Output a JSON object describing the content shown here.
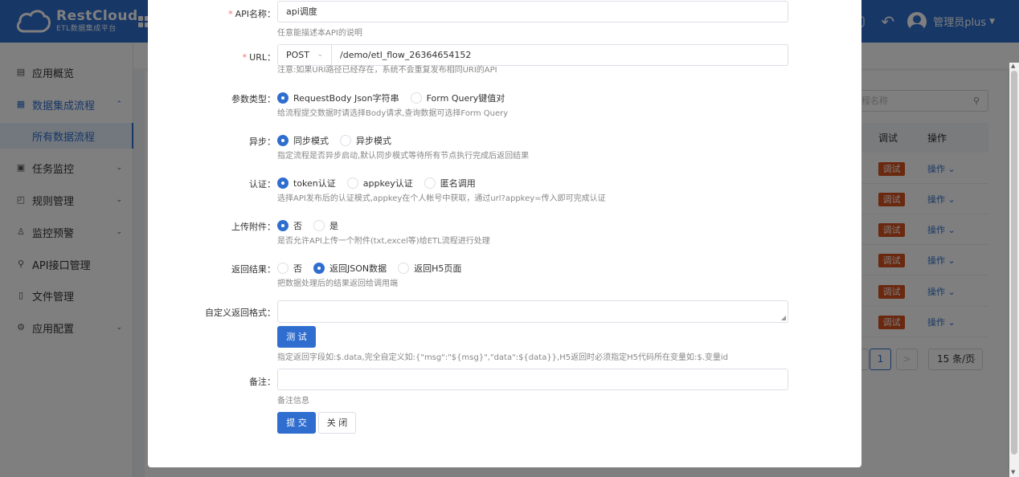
{
  "header": {
    "brand_name": "RestCloud",
    "brand_sub": "ETL数据集成平台",
    "user_name": "管理员plus",
    "user_caret": "▼",
    "back_icon": "↶"
  },
  "sidebar": {
    "items": [
      {
        "label": "应用概览",
        "icon": "▤"
      },
      {
        "label": "数据集成流程",
        "icon": "▦",
        "arrow": "⌃"
      },
      {
        "label": "所有数据流程"
      },
      {
        "label": "任务监控",
        "icon": "▣",
        "arrow": "⌄"
      },
      {
        "label": "规则管理",
        "icon": "◰",
        "arrow": "⌄"
      },
      {
        "label": "监控预警",
        "icon": "♙",
        "arrow": "⌄"
      },
      {
        "label": "API接口管理",
        "icon": "⚲"
      },
      {
        "label": "文件管理",
        "icon": "▯"
      },
      {
        "label": "应用配置",
        "icon": "⚙",
        "arrow": "⌄"
      }
    ]
  },
  "background": {
    "search_placeholder": "程名称",
    "search_icon": "⚲",
    "col_debug": "调试",
    "col_ops": "操作",
    "rows": [
      {
        "debug": "调试",
        "op": "操作 ⌄"
      },
      {
        "debug": "调试",
        "op": "操作 ⌄"
      },
      {
        "debug": "调试",
        "op": "操作 ⌄"
      },
      {
        "debug": "调试",
        "op": "操作 ⌄"
      },
      {
        "debug": "调试",
        "op": "操作 ⌄"
      },
      {
        "debug": "调试",
        "op": "操作 ⌄"
      }
    ],
    "pager_current": "1",
    "pager_next": ">",
    "page_size": "15 条/页"
  },
  "form": {
    "api_name": {
      "label": "API名称：",
      "value": "api调度",
      "hint": "任意能描述本API的说明"
    },
    "url": {
      "label": "URL：",
      "method": "POST",
      "path": "/demo/etl_flow_26364654152",
      "hint": "注意:如果URI路径已经存在，系统不会重复发布相同URI的API"
    },
    "param_type": {
      "label": "参数类型：",
      "options": [
        "RequestBody Json字符串",
        "Form Query键值对"
      ],
      "selected": 0,
      "hint": "给流程提交数据时请选择Body请求,查询数据可选择Form Query"
    },
    "async": {
      "label": "异步：",
      "options": [
        "同步模式",
        "异步模式"
      ],
      "selected": 0,
      "hint": "指定流程是否异步启动,默认同步模式等待所有节点执行完成后返回结果"
    },
    "auth": {
      "label": "认证：",
      "options": [
        "token认证",
        "appkey认证",
        "匿名调用"
      ],
      "selected": 0,
      "hint": "选择API发布后的认证模式,appkey在个人帐号中获取，通过url?appkey=传入即可完成认证"
    },
    "upload": {
      "label": "上传附件：",
      "options": [
        "否",
        "是"
      ],
      "selected": 0,
      "hint": "是否允许API上传一个附件(txt,excel等)给ETL流程进行处理"
    },
    "return_result": {
      "label": "返回结果：",
      "options": [
        "否",
        "返回JSON数据",
        "返回H5页面"
      ],
      "selected": 1,
      "hint": "把数据处理后的结果返回给调用端"
    },
    "custom_format": {
      "label": "自定义返回格式：",
      "value": "",
      "test_button": "测 试",
      "hint": "指定返回字段如:$.data,完全自定义如:{\"msg\":\"${msg}\",\"data\":${data}},H5返回时必须指定H5代码所在变量如:$.变量id"
    },
    "remark": {
      "label": "备注：",
      "value": "",
      "hint": "备注信息"
    },
    "required_mark": "*",
    "submit_button": "提 交",
    "close_button": "关 闭"
  },
  "colors": {
    "primary": "#2f6ecf",
    "danger": "#d4501e",
    "required": "#f56c6c"
  }
}
